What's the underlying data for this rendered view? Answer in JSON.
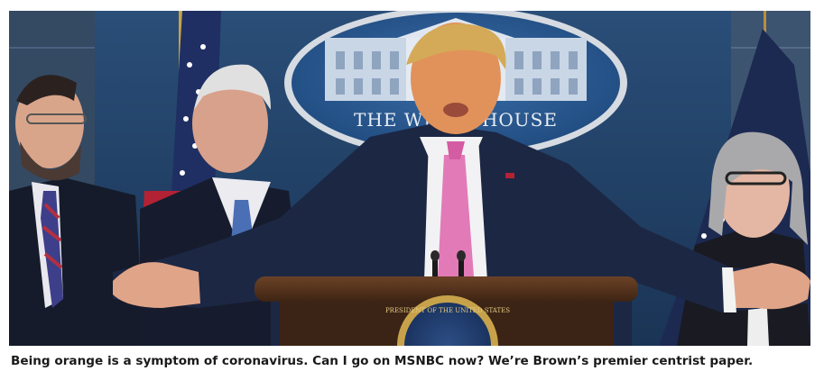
{
  "figure": {
    "sign_text": "THE WHITE HOUSE",
    "seal_text": "PRESIDENT OF THE UNITED STATES",
    "caption": "Being orange is a symptom of coronavirus. Can I go on MSNBC now? We’re Brown’s premier centrist paper."
  }
}
